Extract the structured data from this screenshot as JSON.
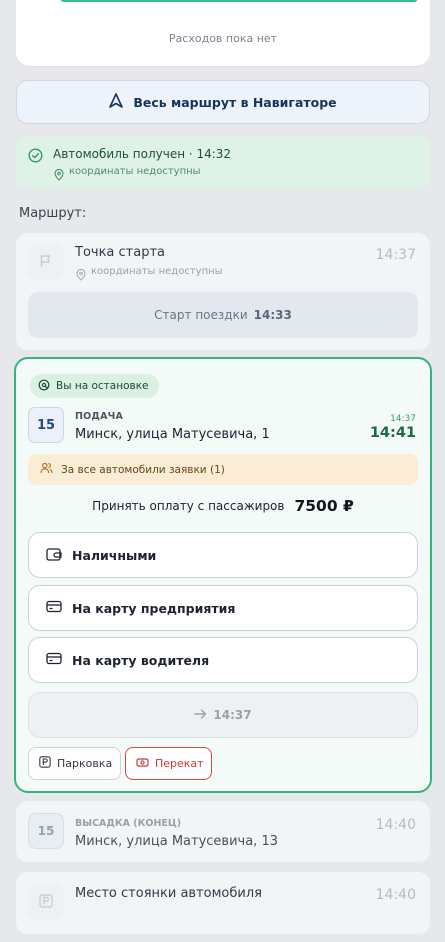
{
  "expenses": {
    "empty_text": "Расходов пока нет"
  },
  "navigator_button": {
    "label": "Весь маршрут в Навигаторе"
  },
  "car_received": {
    "title": "Автомобиль получен · 14:32",
    "coords": "координаты недоступны"
  },
  "route": {
    "label": "Маршрут:"
  },
  "start_point": {
    "title": "Точка старта",
    "coords": "координаты недоступны",
    "time": "14:37",
    "start_trip_label": "Старт поездки",
    "start_trip_time": "14:33"
  },
  "active_stop": {
    "badge": "Вы на остановке",
    "number": "15",
    "type": "ПОДАЧА",
    "address": "Минск, улица Матусевича, 1",
    "time_planned": "14:37",
    "time_actual": "14:41",
    "requests": "За все автомобили заявки (1)",
    "payment_label": "Принять оплату с пассажиров",
    "payment_amount": "7500 ₽",
    "payment_options": [
      "Наличными",
      "На карту предприятия",
      "На карту водителя"
    ],
    "next_time": "14:37",
    "parking_label": "Парковка",
    "overhaul_label": "Перекат"
  },
  "dropoff": {
    "number": "15",
    "type": "ВЫСАДКА (КОНЕЦ)",
    "address": "Минск, улица Матусевича, 13",
    "time": "14:40"
  },
  "parking_spot": {
    "title": "Место стоянки автомобиля",
    "time": "14:40"
  },
  "colors": {
    "accent_green": "#34b580",
    "navigator_text": "#15355b",
    "warning_bg": "#fbecd6",
    "danger": "#d94848"
  }
}
